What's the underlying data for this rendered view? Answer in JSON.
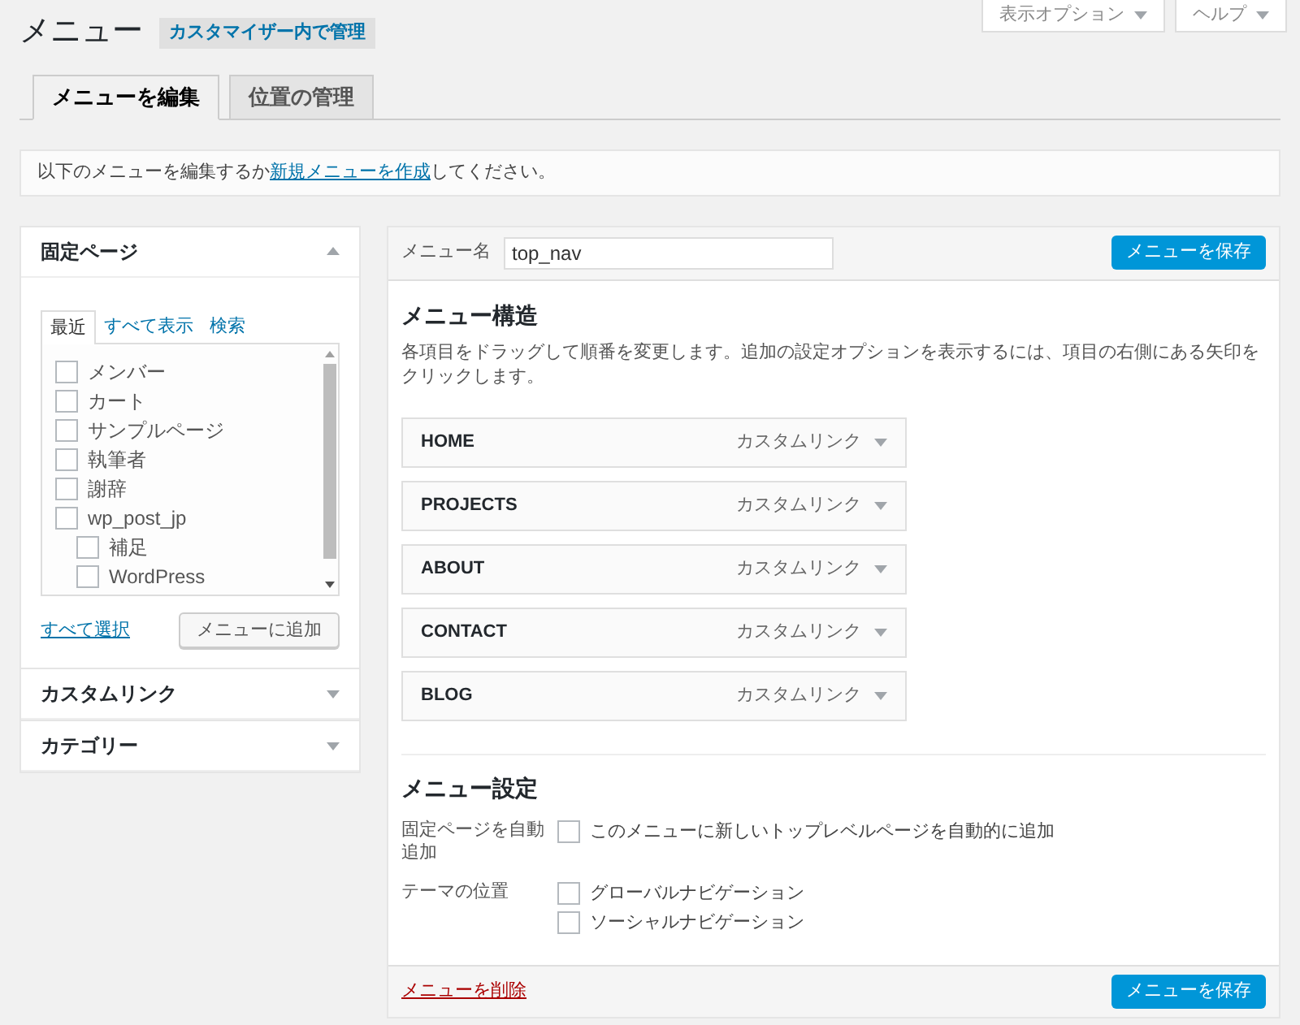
{
  "header": {
    "title": "メニュー",
    "manage_button": "カスタマイザー内で管理",
    "screen_options": "表示オプション",
    "help": "ヘルプ"
  },
  "tabs": [
    {
      "label": "メニューを編集",
      "selected": true
    },
    {
      "label": "位置の管理",
      "selected": false
    }
  ],
  "notice": {
    "text_before": "以下のメニューを編集するか",
    "link": "新規メニューを作成",
    "text_after": "してください。"
  },
  "sidebar": {
    "sections": [
      {
        "title": "固定ページ",
        "expanded": true,
        "tabs": [
          {
            "label": "最近",
            "selected": true
          },
          {
            "label": "すべて表示",
            "selected": false
          },
          {
            "label": "検索",
            "selected": false
          }
        ],
        "pages": [
          {
            "label": "メンバー",
            "checked": false
          },
          {
            "label": "カート",
            "checked": false
          },
          {
            "label": "サンプルページ",
            "checked": false
          },
          {
            "label": "執筆者",
            "checked": false
          },
          {
            "label": "謝辞",
            "checked": false
          },
          {
            "label": "wp_post_jp",
            "checked": false,
            "children": [
              {
                "label": "補足",
                "checked": false
              },
              {
                "label": "WordPress",
                "checked": false
              }
            ]
          }
        ],
        "select_all": "すべて選択",
        "add_button": "メニューに追加"
      },
      {
        "title": "カスタムリンク",
        "expanded": false
      },
      {
        "title": "カテゴリー",
        "expanded": false
      }
    ]
  },
  "editor": {
    "name_label": "メニュー名",
    "name_value": "top_nav",
    "save_button": "メニューを保存",
    "structure_title": "メニュー構造",
    "structure_help": "各項目をドラッグして順番を変更します。追加の設定オプションを表示するには、項目の右側にある矢印をクリックします。",
    "items": [
      {
        "title": "HOME",
        "type": "カスタムリンク"
      },
      {
        "title": "PROJECTS",
        "type": "カスタムリンク"
      },
      {
        "title": "ABOUT",
        "type": "カスタムリンク"
      },
      {
        "title": "CONTACT",
        "type": "カスタムリンク"
      },
      {
        "title": "BLOG",
        "type": "カスタムリンク"
      }
    ],
    "settings_title": "メニュー設定",
    "settings": [
      {
        "label": "固定ページを自動追加",
        "options": [
          {
            "label": "このメニューに新しいトップレベルページを自動的に追加",
            "checked": false
          }
        ]
      },
      {
        "label": "テーマの位置",
        "options": [
          {
            "label": "グローバルナビゲーション",
            "checked": false
          },
          {
            "label": "ソーシャルナビゲーション",
            "checked": false
          }
        ]
      }
    ],
    "delete_link": "メニューを削除",
    "footer_save_button": "メニューを保存"
  }
}
